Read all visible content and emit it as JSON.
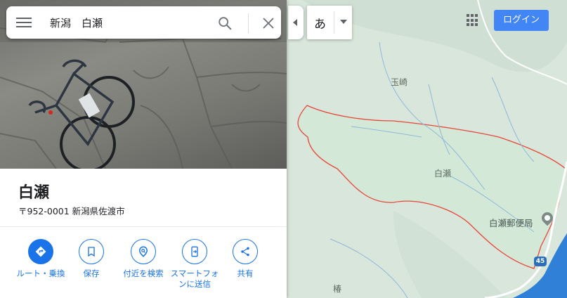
{
  "search": {
    "query": "新潟　白瀬"
  },
  "place": {
    "title": "白瀬",
    "address": "〒952-0001 新潟県佐渡市"
  },
  "actions": [
    {
      "label": "ルート・乗換",
      "icon": "directions-icon"
    },
    {
      "label": "保存",
      "icon": "bookmark-icon"
    },
    {
      "label": "付近を検索",
      "icon": "nearby-icon"
    },
    {
      "label": "スマートフォンに送信",
      "icon": "send-to-phone-icon"
    },
    {
      "label": "共有",
      "icon": "share-icon"
    }
  ],
  "input_method": {
    "char": "あ"
  },
  "header": {
    "login_label": "ログイン"
  },
  "map": {
    "labels": {
      "tamazaki": "玉崎",
      "shirase": "白瀬",
      "tsubaki": "椿"
    },
    "poi": {
      "post_office": "白瀬郵便局"
    },
    "route_shield": "45"
  },
  "colors": {
    "accent": "#1a73e8",
    "login": "#4285f4",
    "boundary": "#e8463a",
    "sea": "#2f80d6"
  }
}
